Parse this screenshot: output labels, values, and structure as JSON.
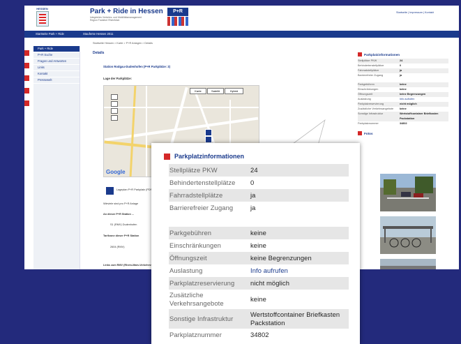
{
  "header": {
    "logo_text": "HESSEN",
    "site_title": "Park + Ride in Hessen",
    "site_sub": "Integriertes Verkehrs- und Mobilitätsmanagement Region Frankfurt RheinMain",
    "badge": "P+R",
    "top_links": "Startseite | Impressum | Kontakt"
  },
  "nav": {
    "item1": "Startseite Park + Ride",
    "item2": "Stauferse Hessen 2011"
  },
  "breadcrumb": "Startseite Hessen > Karte > P+R Anlagen > Details",
  "sidebar": {
    "items": [
      "Park + Ride",
      "P+R Suche",
      "Fragen und Antworten",
      "Links",
      "Kontakt",
      "Pressewelt"
    ]
  },
  "main": {
    "heading": "Details",
    "station": "Station Rodgau-Dudenhofen (P+R Parkplätze: 3)",
    "lage": "Lage der Parkplätze:",
    "map_buttons": [
      "Karte",
      "Satellit",
      "Hybrid"
    ],
    "google": "Google",
    "pdf_text": "Lageplan P+R Parkplatz (PDF)",
    "text1": "Wieviele sind pro P+R Anlage",
    "text2": "An dieser P+R Station ...",
    "text3": "S1 (RMV) Dudenhofen",
    "text4": "Tarifzone dieser P+R Station",
    "text5": "2604 (RMV)",
    "text6": "Links zum RMV (Rhein-Main-Verkehrsverbund)"
  },
  "right": {
    "title": "Parkplatzinformationen",
    "rows1": [
      {
        "k": "Stellplätze PKW",
        "v": "24"
      },
      {
        "k": "Behindertenstellplätze",
        "v": "0"
      },
      {
        "k": "Fahrradstellplätze",
        "v": "ja"
      },
      {
        "k": "Barrierefreier Zugang",
        "v": "ja"
      }
    ],
    "rows2": [
      {
        "k": "Parkgebühren",
        "v": "keine"
      },
      {
        "k": "Einschränkungen",
        "v": "keine"
      },
      {
        "k": "Öffnungszeit",
        "v": "keine Begrenzungen"
      },
      {
        "k": "Auslastung",
        "v": "Info aufrufen"
      },
      {
        "k": "Parkplatzreservierung",
        "v": "nicht möglich"
      },
      {
        "k": "Zusätzliche Verkehrsangebote",
        "v": "keine"
      },
      {
        "k": "Sonstige Infrastruktur",
        "v": "Wertstoffcontainer Briefkasten Packstation"
      },
      {
        "k": "Parkplatznummer",
        "v": "34802"
      }
    ],
    "photos_title": "Fotos"
  },
  "callout": {
    "title": "Parkplatzinformationen",
    "rows": [
      {
        "k": "Stellplätze PKW",
        "v": "24"
      },
      {
        "k": "Behindertenstellplätze",
        "v": "0"
      },
      {
        "k": "Fahrradstellplätze",
        "v": "ja"
      },
      {
        "k": "Barrierefreier Zugang",
        "v": "ja"
      },
      {
        "k": "Parkgebühren",
        "v": "keine"
      },
      {
        "k": "Einschränkungen",
        "v": "keine"
      },
      {
        "k": "Öffnungszeit",
        "v": "keine Begrenzungen"
      },
      {
        "k": "Auslastung",
        "v": "Info aufrufen"
      },
      {
        "k": "Parkplatzreservierung",
        "v": "nicht möglich"
      },
      {
        "k": "Zusätzliche Verkehrsangebote",
        "v": "keine"
      },
      {
        "k": "Sonstige Infrastruktur",
        "v": "Wertstoffcontainer Briefkasten Packstation"
      },
      {
        "k": "Parkplatznummer",
        "v": "34802"
      }
    ]
  },
  "colors": {
    "background": "#232a7c",
    "brand_blue": "#1a3a8c",
    "accent_red": "#d42828"
  }
}
